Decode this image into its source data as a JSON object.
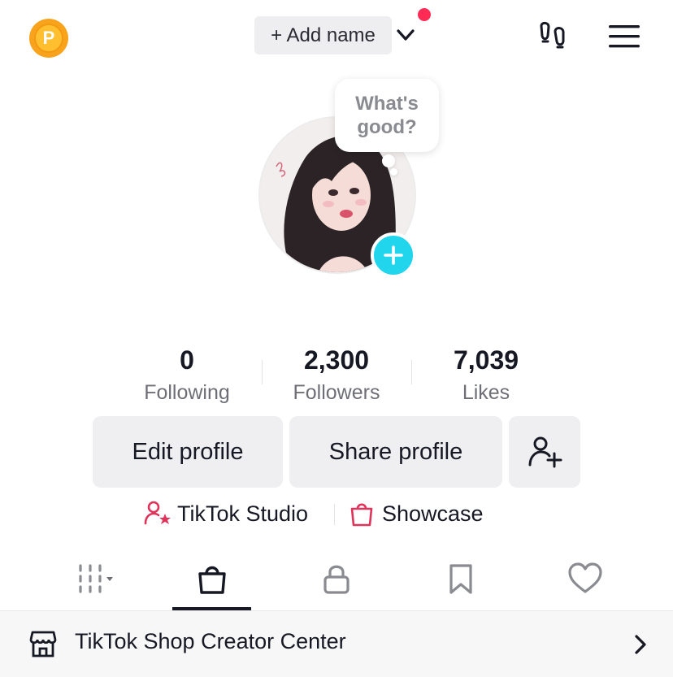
{
  "header": {
    "coin_letter": "P",
    "add_name_label": "+ Add name",
    "icons": [
      "coin-icon",
      "chevron-down-icon",
      "notification-dot",
      "footprints-icon",
      "menu-icon"
    ]
  },
  "avatar": {
    "bubble_text": "What's good?",
    "add_icon": "plus-icon"
  },
  "stats": [
    {
      "value": "0",
      "label": "Following"
    },
    {
      "value": "2,300",
      "label": "Followers"
    },
    {
      "value": "7,039",
      "label": "Likes"
    }
  ],
  "actions": {
    "edit_profile": "Edit profile",
    "share_profile": "Share profile",
    "add_friend_icon": "add-friend-icon"
  },
  "links": {
    "studio": "TikTok Studio",
    "showcase": "Showcase"
  },
  "tabs": [
    {
      "icon": "grid-icon",
      "active": false
    },
    {
      "icon": "shopping-bag-icon",
      "active": true
    },
    {
      "icon": "lock-icon",
      "active": false
    },
    {
      "icon": "bookmark-icon",
      "active": false
    },
    {
      "icon": "heart-icon",
      "active": false
    }
  ],
  "shop_row": {
    "label": "TikTok Shop Creator Center"
  },
  "colors": {
    "accent_red": "#fe2c55",
    "plus_cyan": "#20d5ec",
    "coin": "#f8a31b"
  }
}
